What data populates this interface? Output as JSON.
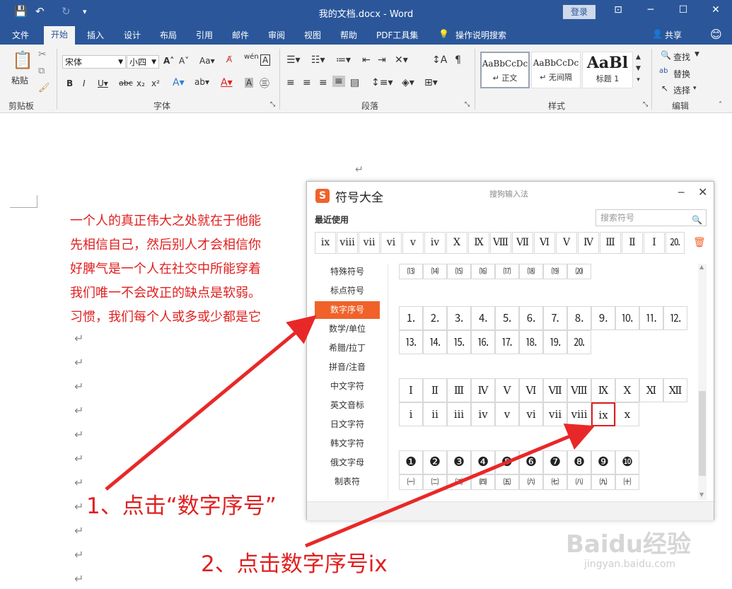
{
  "window": {
    "title": "我的文档.docx - Word",
    "login_label": "登录",
    "controls": [
      "⊡",
      "─",
      "☐",
      "✕"
    ]
  },
  "tabs": [
    "文件",
    "开始",
    "插入",
    "设计",
    "布局",
    "引用",
    "邮件",
    "审阅",
    "视图",
    "帮助",
    "PDF工具集"
  ],
  "tell_me": "操作说明搜索",
  "share": "共享",
  "ribbon": {
    "clipboard": {
      "paste": "粘贴",
      "label": "剪贴板"
    },
    "font": {
      "name": "宋体",
      "size": "小四",
      "label": "字体"
    },
    "paragraph": {
      "label": "段落"
    },
    "styles": {
      "label": "样式",
      "items": [
        {
          "sample": "AaBbCcDc",
          "name": "↵ 正文"
        },
        {
          "sample": "AaBbCcDc",
          "name": "↵ 无间隔"
        },
        {
          "sample": "AaBl",
          "name": "标题 1"
        }
      ]
    },
    "editing": {
      "find": "查找",
      "replace": "替换",
      "select": "选择",
      "label": "编辑"
    }
  },
  "document": {
    "lines": [
      "一个人的真正伟大之处就在于他能",
      "先相信自己，然后别人才会相信你",
      "好脾气是一个人在社交中所能穿着",
      "我们唯一不会改正的缺点是软弱。",
      "习惯，我们每个人或多或少都是它"
    ]
  },
  "dialog": {
    "title": "符号大全",
    "subtitle": "搜狗输入法",
    "recent_label": "最近使用",
    "search_placeholder": "搜索符号",
    "recent": [
      "ⅸ",
      "ⅷ",
      "ⅶ",
      "ⅵ",
      "ⅴ",
      "ⅳ",
      "Ⅹ",
      "Ⅸ",
      "Ⅷ",
      "Ⅶ",
      "Ⅵ",
      "Ⅴ",
      "Ⅳ",
      "Ⅲ",
      "Ⅱ",
      "Ⅰ",
      "⒛"
    ],
    "categories": [
      "特殊符号",
      "标点符号",
      "数字序号",
      "数学/单位",
      "希腊/拉丁",
      "拼音/注音",
      "中文字符",
      "英文音标",
      "日文字符",
      "韩文字符",
      "俄文字母",
      "制表符"
    ],
    "active_category": "数字序号",
    "rows": [
      [
        "⒀",
        "⒁",
        "⒂",
        "⒃",
        "⒄",
        "⒅",
        "⒆",
        "⒇"
      ],
      [
        "⒈",
        "⒉",
        "⒊",
        "⒋",
        "⒌",
        "⒍",
        "⒎",
        "⒏",
        "⒐",
        "⒑",
        "⒒",
        "⒓"
      ],
      [
        "⒔",
        "⒕",
        "⒖",
        "⒗",
        "⒘",
        "⒙",
        "⒚",
        "⒛"
      ],
      [
        "Ⅰ",
        "Ⅱ",
        "Ⅲ",
        "Ⅳ",
        "Ⅴ",
        "Ⅵ",
        "Ⅶ",
        "Ⅷ",
        "Ⅸ",
        "Ⅹ",
        "Ⅺ",
        "Ⅻ"
      ],
      [
        "ⅰ",
        "ⅱ",
        "ⅲ",
        "ⅳ",
        "ⅴ",
        "ⅵ",
        "ⅶ",
        "ⅷ",
        "ⅸ",
        "ⅹ"
      ],
      [
        "❶",
        "❷",
        "❸",
        "❹",
        "❺",
        "❻",
        "❼",
        "❽",
        "❾",
        "❿"
      ],
      [
        "㈠",
        "㈡",
        "㈢",
        "㈣",
        "㈤",
        "㈥",
        "㈦",
        "㈧",
        "㈨",
        "㈩"
      ]
    ],
    "highlighted": "ⅸ"
  },
  "annotations": [
    "1、点击“数字序号”",
    "2、点击数字序号ix"
  ],
  "watermark": {
    "brand": "Baidu经验",
    "url": "jingyan.baidu.com"
  },
  "colors": {
    "word_blue": "#2b579a",
    "accent_orange": "#f0622a",
    "annotation_red": "#e02020"
  }
}
